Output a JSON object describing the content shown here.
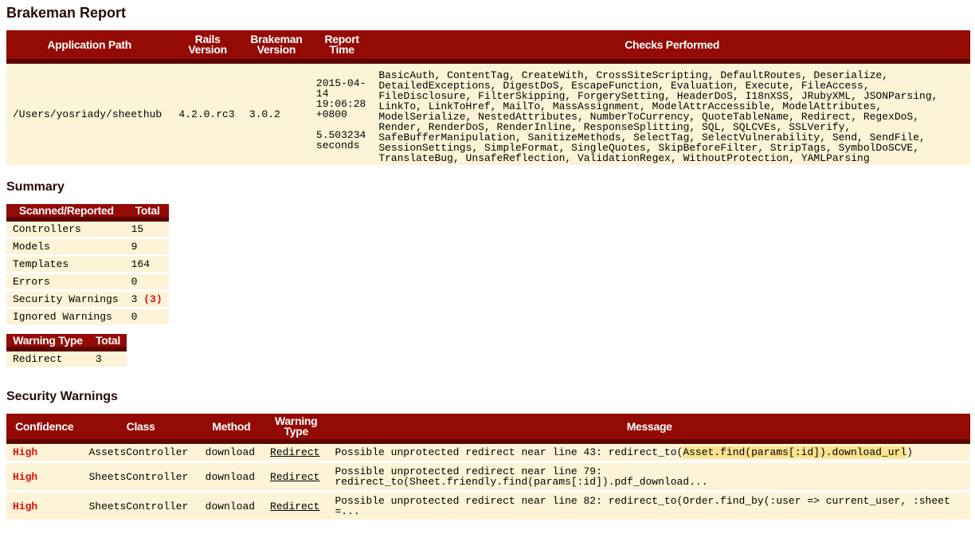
{
  "page": {
    "title": "Brakeman Report"
  },
  "info_table": {
    "headers": {
      "app_path": "Application Path",
      "rails_version": "Rails Version",
      "brakeman_version": "Brakeman Version",
      "report_time": "Report Time",
      "checks": "Checks Performed"
    },
    "row": {
      "app_path": "/Users/yosriady/sheethub",
      "rails_version": "4.2.0.rc3",
      "brakeman_version": "3.0.2",
      "report_time": "2015-04-14 19:06:28 +0800",
      "duration": "5.503234 seconds",
      "checks": "BasicAuth, ContentTag, CreateWith, CrossSiteScripting, DefaultRoutes, Deserialize, DetailedExceptions, DigestDoS, EscapeFunction, Evaluation, Execute, FileAccess, FileDisclosure, FilterSkipping, ForgerySetting, HeaderDoS, I18nXSS, JRubyXML, JSONParsing, LinkTo, LinkToHref, MailTo, MassAssignment, ModelAttrAccessible, ModelAttributes, ModelSerialize, NestedAttributes, NumberToCurrency, QuoteTableName, Redirect, RegexDoS, Render, RenderDoS, RenderInline, ResponseSplitting, SQL, SQLCVEs, SSLVerify, SafeBufferManipulation, SanitizeMethods, SelectTag, SelectVulnerability, Send, SendFile, SessionSettings, SimpleFormat, SingleQuotes, SkipBeforeFilter, StripTags, SymbolDoSCVE, TranslateBug, UnsafeReflection, ValidationRegex, WithoutProtection, YAMLParsing"
    }
  },
  "summary": {
    "title": "Summary",
    "headers": {
      "label": "Scanned/Reported",
      "total": "Total"
    },
    "rows": [
      {
        "label": "Controllers",
        "total": "15"
      },
      {
        "label": "Models",
        "total": "9"
      },
      {
        "label": "Templates",
        "total": "164"
      },
      {
        "label": "Errors",
        "total": "0"
      },
      {
        "label": "Security Warnings",
        "total": "3",
        "extra": "(3)"
      },
      {
        "label": "Ignored Warnings",
        "total": "0"
      }
    ]
  },
  "warning_types": {
    "headers": {
      "type": "Warning Type",
      "total": "Total"
    },
    "rows": [
      {
        "type": "Redirect",
        "total": "3"
      }
    ]
  },
  "security_warnings": {
    "title": "Security Warnings",
    "headers": {
      "confidence": "Confidence",
      "class": "Class",
      "method": "Method",
      "warning_type": "Warning Type",
      "message": "Message"
    },
    "rows": [
      {
        "confidence": "High",
        "class": "AssetsController",
        "method": "download",
        "warning_type": "Redirect",
        "message_prefix": "Possible unprotected redirect near line 43: redirect_to(",
        "message_highlight": "Asset.find(params[:id]).download_url",
        "message_suffix": ")"
      },
      {
        "confidence": "High",
        "class": "SheetsController",
        "method": "download",
        "warning_type": "Redirect",
        "message_prefix": "Possible unprotected redirect near line 79: redirect_to(Sheet.friendly.find(params[:id]).pdf_download...",
        "message_highlight": "",
        "message_suffix": ""
      },
      {
        "confidence": "High",
        "class": "SheetsController",
        "method": "download",
        "warning_type": "Redirect",
        "message_prefix": "Possible unprotected redirect near line 82: redirect_to(Order.find_by(:user => current_user, :sheet =...",
        "message_highlight": "",
        "message_suffix": ""
      }
    ]
  }
}
